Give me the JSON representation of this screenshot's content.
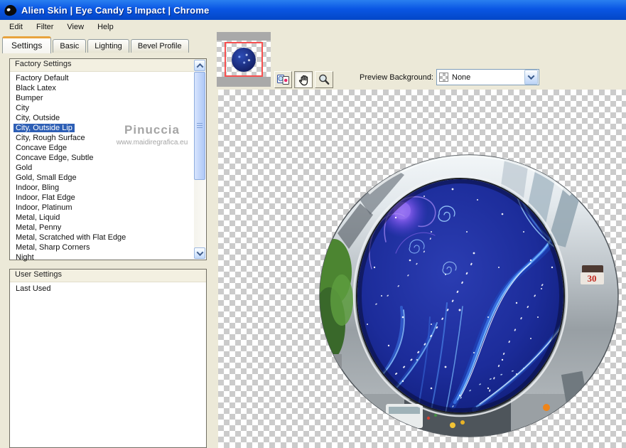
{
  "titlebar": {
    "title": "Alien Skin  |  Eye Candy 5 Impact  |  Chrome"
  },
  "menubar": {
    "items": [
      "Edit",
      "Filter",
      "View",
      "Help"
    ]
  },
  "tabs": [
    {
      "label": "Settings",
      "active": true
    },
    {
      "label": "Basic",
      "active": false
    },
    {
      "label": "Lighting",
      "active": false
    },
    {
      "label": "Bevel Profile",
      "active": false
    }
  ],
  "factory": {
    "header": "Factory Settings",
    "items": [
      "Factory Default",
      "Black Latex",
      "Bumper",
      "City",
      "City, Outside",
      "City, Outside Lip",
      "City, Rough Surface",
      "Concave Edge",
      "Concave Edge, Subtle",
      "Gold",
      "Gold, Small Edge",
      "Indoor, Bling",
      "Indoor, Flat Edge",
      "Indoor, Platinum",
      "Metal, Liquid",
      "Metal, Penny",
      "Metal, Scratched with Flat Edge",
      "Metal, Sharp Corners",
      "Night"
    ],
    "selected": "City, Outside Lip",
    "selected_index": 5
  },
  "user": {
    "header": "User Settings",
    "items": [
      "Last Used"
    ]
  },
  "toolbar": {
    "tools": [
      "compare-preview",
      "hand-pan",
      "zoom"
    ],
    "active_tool": "hand-pan",
    "preview_bg_label": "Preview Background:",
    "preview_bg_value": "None"
  },
  "watermark": {
    "name": "Pinuccia",
    "url": "www.maidiregrafica.eu"
  },
  "preview": {
    "sign_text": "30"
  },
  "colors": {
    "titlebar_blue": "#0a56e4",
    "selection_blue": "#2e5fb5",
    "tab_accent_orange": "#e8a33d",
    "panel_beige": "#ece9d8",
    "checker_gray": "#cbcbcb",
    "sign_red": "#c1271d",
    "disc_blue": "#1c2c9a",
    "chrome_silver": "#b9c0c5"
  }
}
